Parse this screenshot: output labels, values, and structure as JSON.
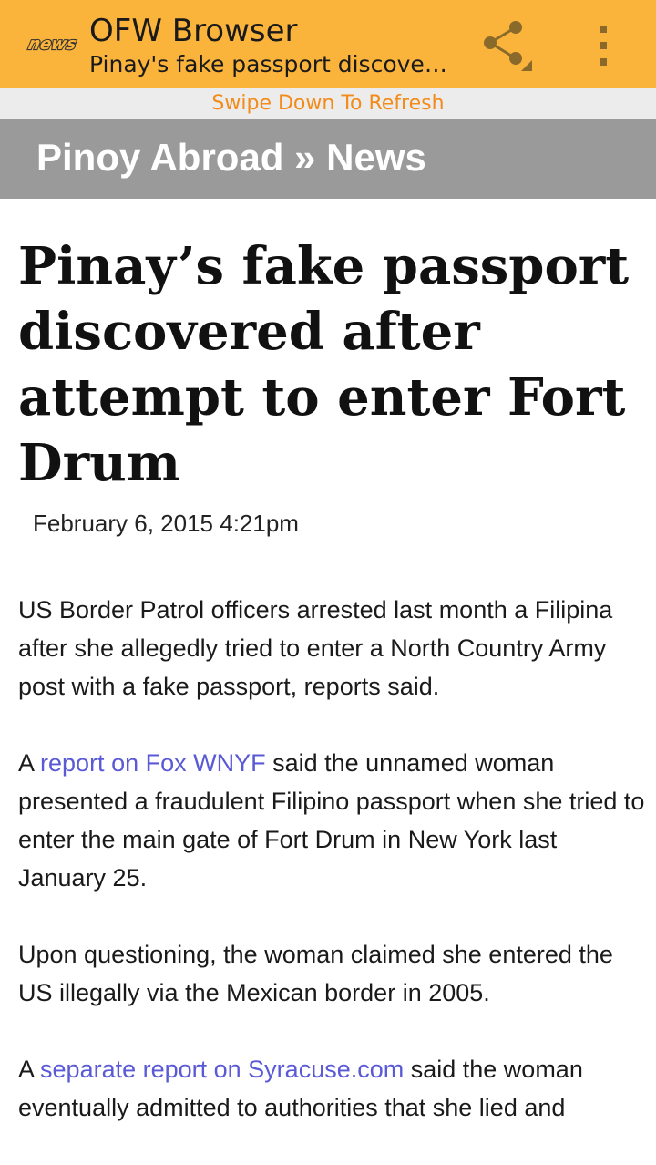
{
  "appbar": {
    "logo_text": "news",
    "title": "OFW Browser",
    "subtitle": "Pinay's fake passport discovered after attempt to enter Fort Drum"
  },
  "refresh": {
    "label": "Swipe Down To Refresh"
  },
  "section": {
    "breadcrumb": "Pinoy Abroad » News"
  },
  "article": {
    "title": "Pinay’s fake passport discovered after attempt to enter Fort Drum",
    "date": "February 6, 2015 4:21pm",
    "p1": "US Border Patrol officers arrested last month a Filipina after she allegedly tried to enter a North Country Army post with a fake passport, reports said.",
    "p2_pre": "A ",
    "p2_link": "report on Fox WNYF",
    "p2_post": " said the unnamed woman presented a fraudulent Filipino passport when she tried to enter the main gate of Fort Drum in New York last January 25.",
    "p3": "Upon questioning, the woman claimed she entered the US illegally via the Mexican border in 2005.",
    "p4_pre": "A ",
    "p4_link": "separate report on Syracuse.com",
    "p4_post": " said the woman eventually admitted to authorities that she lied and"
  },
  "colors": {
    "appbar": "#fbb43b",
    "refresh_text": "#f28b1a",
    "section_bar": "#9a9a9a",
    "link": "#5a5ad6"
  },
  "icons": {
    "logo": "news-logo-icon",
    "share": "share-icon",
    "overflow": "overflow-menu-icon"
  }
}
